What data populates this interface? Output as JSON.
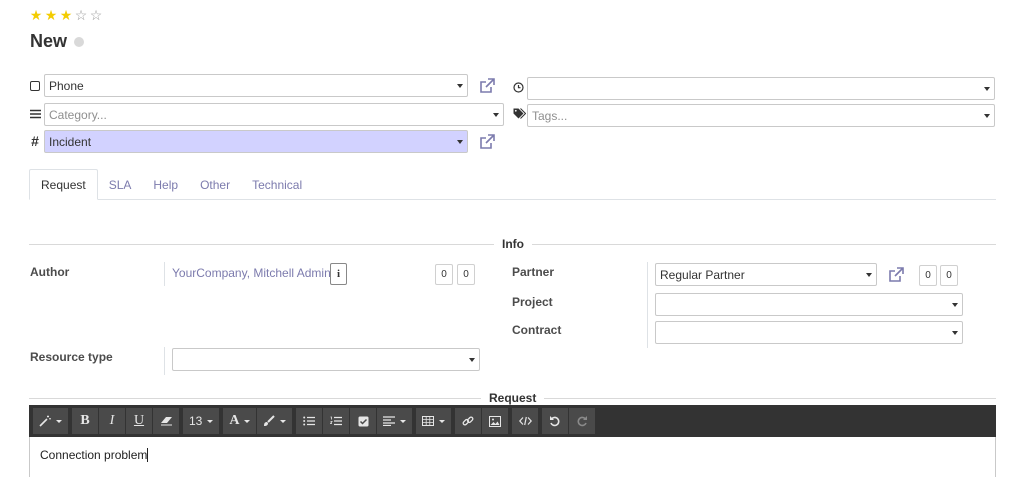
{
  "priority": {
    "filled": 3,
    "total": 5
  },
  "record": {
    "title": "New"
  },
  "fields": {
    "channel": {
      "value": "Phone",
      "icon": "square-icon"
    },
    "deadline": {
      "value": "",
      "icon": "clock-icon"
    },
    "category": {
      "placeholder": "Category...",
      "icon": "list-icon"
    },
    "tags": {
      "placeholder": "Tags...",
      "icon": "tag-icon"
    },
    "type": {
      "value": "Incident",
      "icon": "hash-icon"
    }
  },
  "tabs": [
    {
      "label": "Request",
      "active": true
    },
    {
      "label": "SLA",
      "active": false
    },
    {
      "label": "Help",
      "active": false
    },
    {
      "label": "Other",
      "active": false
    },
    {
      "label": "Technical",
      "active": false
    }
  ],
  "info": {
    "section_title": "Info",
    "author_label": "Author",
    "author_value": "YourCompany, Mitchell Admin",
    "author_info_glyph": "i",
    "author_count_a": "0",
    "author_count_b": "0",
    "partner_label": "Partner",
    "partner_value": "Regular Partner",
    "partner_count_a": "0",
    "partner_count_b": "0",
    "project_label": "Project",
    "contract_label": "Contract",
    "resource_type_label": "Resource type"
  },
  "request": {
    "section_title": "Request",
    "font_size": "13",
    "body_text": "Connection problem"
  },
  "colors": {
    "star_on": "#f3cc00",
    "link": "#7c7bad",
    "highlight": "#d2d2ff",
    "toolbar_bg": "#333333"
  }
}
